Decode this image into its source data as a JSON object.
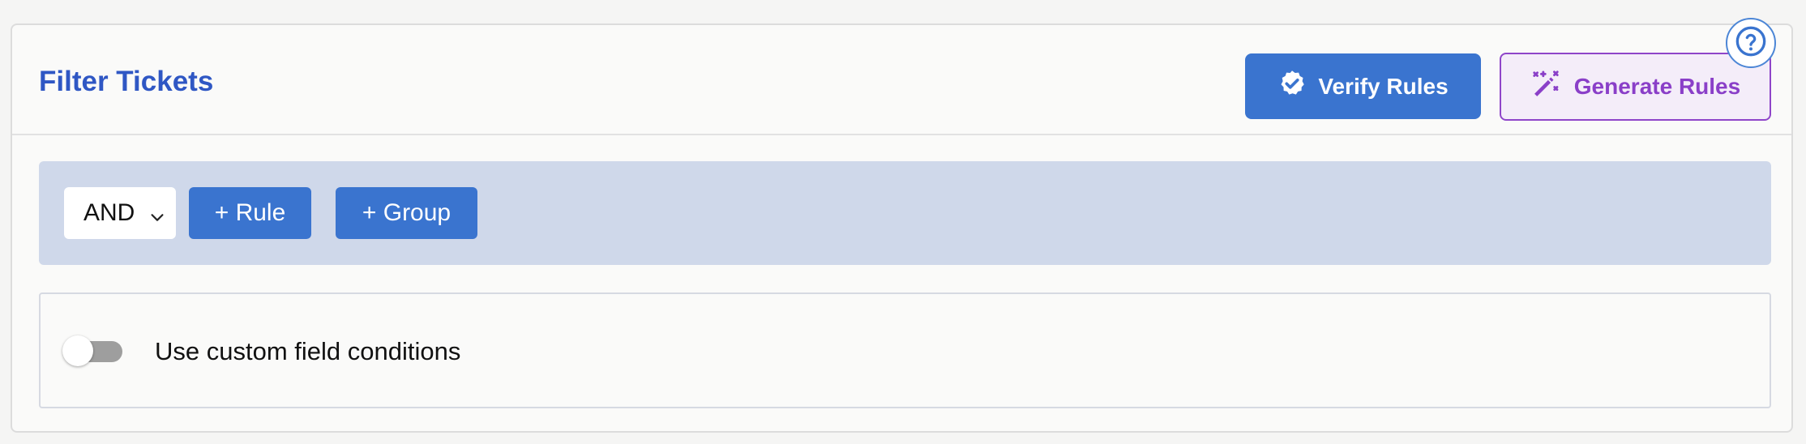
{
  "header": {
    "title": "Filter Tickets",
    "verify_label": "Verify Rules",
    "generate_label": "Generate Rules",
    "help_icon": "question-circle-icon"
  },
  "rules_bar": {
    "combinator_value": "AND",
    "add_rule_label": "+ Rule",
    "add_group_label": "+ Group"
  },
  "custom_fields": {
    "toggle_label": "Use custom field conditions",
    "enabled": false
  },
  "colors": {
    "title": "#2f57c4",
    "primary": "#3a74cf",
    "accent_purple": "#8a3fc8",
    "rules_bar_bg": "#cfd8ea"
  }
}
